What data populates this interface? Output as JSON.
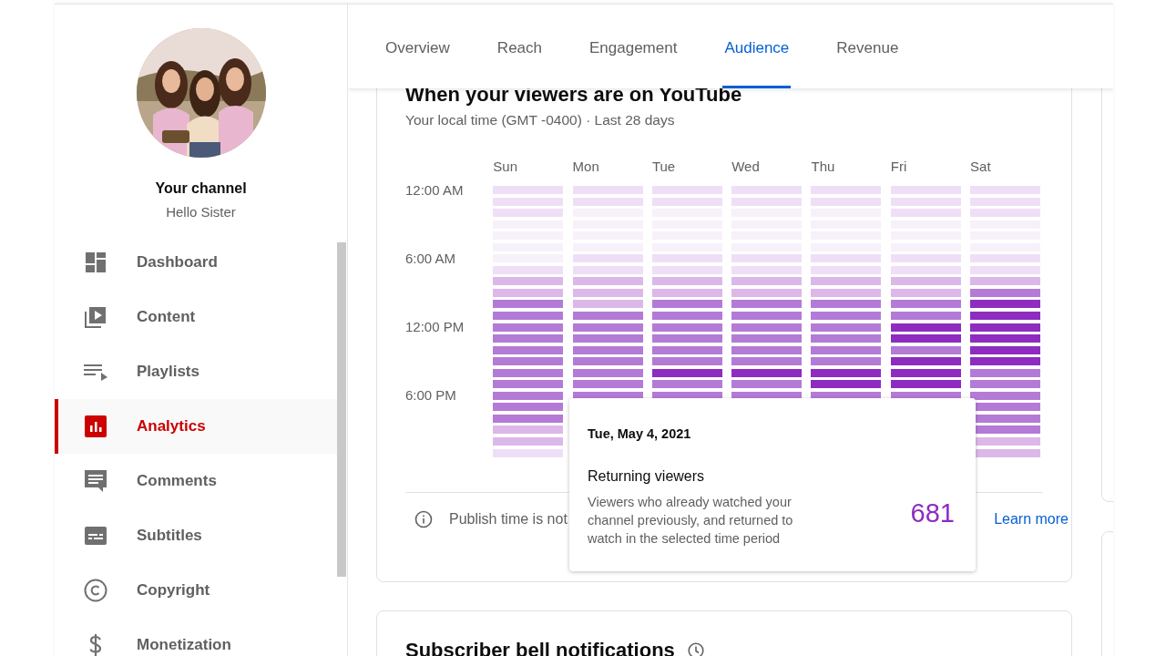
{
  "sidebar": {
    "channel_title": "Your channel",
    "channel_name": "Hello Sister",
    "items": [
      {
        "label": "Dashboard",
        "selected": false
      },
      {
        "label": "Content",
        "selected": false
      },
      {
        "label": "Playlists",
        "selected": false
      },
      {
        "label": "Analytics",
        "selected": true
      },
      {
        "label": "Comments",
        "selected": false
      },
      {
        "label": "Subtitles",
        "selected": false
      },
      {
        "label": "Copyright",
        "selected": false
      },
      {
        "label": "Monetization",
        "selected": false
      }
    ]
  },
  "tabs": [
    {
      "label": "Overview",
      "selected": false
    },
    {
      "label": "Reach",
      "selected": false
    },
    {
      "label": "Engagement",
      "selected": false
    },
    {
      "label": "Audience",
      "selected": true
    },
    {
      "label": "Revenue",
      "selected": false
    }
  ],
  "viewers_card": {
    "title": "When your viewers are on YouTube",
    "subtitle": "Your local time (GMT -0400) · Last 28 days",
    "heatmap": {
      "time_labels": [
        "12:00 AM",
        "6:00 AM",
        "12:00 PM",
        "6:00 PM"
      ],
      "days": [
        {
          "label": "Sun",
          "cells": [
            {
              "color": "#eedff7"
            },
            {
              "color": "#eedff7"
            },
            {
              "color": "#eedff7"
            },
            {
              "color": "#f7f1fa"
            },
            {
              "color": "#f7f1fa"
            },
            {
              "color": "#f7f1fa"
            },
            {
              "color": "#f7f1fa"
            },
            {
              "color": "#eedff7"
            },
            {
              "color": "#dcb8e9"
            },
            {
              "color": "#dcb8e9"
            },
            {
              "color": "#b47bd6"
            },
            {
              "color": "#b47bd6"
            },
            {
              "color": "#b47bd6"
            },
            {
              "color": "#b47bd6"
            },
            {
              "color": "#b47bd6"
            },
            {
              "color": "#b47bd6"
            },
            {
              "color": "#b47bd6"
            },
            {
              "color": "#b47bd6"
            },
            {
              "color": "#b47bd6"
            },
            {
              "color": "#b47bd6"
            },
            {
              "color": "#b47bd6"
            },
            {
              "color": "#dcb8e9"
            },
            {
              "color": "#dcb8e9"
            },
            {
              "color": "#eedff7"
            }
          ]
        },
        {
          "label": "Mon",
          "cells": [
            {
              "color": "#eedff7"
            },
            {
              "color": "#eedff7"
            },
            {
              "color": "#f7f1fa"
            },
            {
              "color": "#f7f1fa"
            },
            {
              "color": "#f7f1fa"
            },
            {
              "color": "#f7f1fa"
            },
            {
              "color": "#eedff7"
            },
            {
              "color": "#eedff7"
            },
            {
              "color": "#dcb8e9"
            },
            {
              "color": "#dcb8e9"
            },
            {
              "color": "#dcb8e9"
            },
            {
              "color": "#b47bd6"
            },
            {
              "color": "#b47bd6"
            },
            {
              "color": "#b47bd6"
            },
            {
              "color": "#b47bd6"
            },
            {
              "color": "#b47bd6"
            },
            {
              "color": "#b47bd6"
            },
            {
              "color": "#b47bd6"
            },
            {
              "color": "#b47bd6"
            }
          ]
        },
        {
          "label": "Tue",
          "cells": [
            {
              "color": "#eedff7"
            },
            {
              "color": "#eedff7"
            },
            {
              "color": "#f7f1fa"
            },
            {
              "color": "#f7f1fa"
            },
            {
              "color": "#f7f1fa"
            },
            {
              "color": "#f7f1fa"
            },
            {
              "color": "#eedff7"
            },
            {
              "color": "#eedff7"
            },
            {
              "color": "#dcb8e9"
            },
            {
              "color": "#dcb8e9"
            },
            {
              "color": "#b47bd6"
            },
            {
              "color": "#b47bd6"
            },
            {
              "color": "#b47bd6"
            },
            {
              "color": "#b47bd6"
            },
            {
              "color": "#b47bd6"
            },
            {
              "color": "#b47bd6"
            },
            {
              "color": "#8e2cc0"
            },
            {
              "color": "#b47bd6"
            },
            {
              "color": "#b47bd6"
            }
          ]
        },
        {
          "label": "Wed",
          "cells": [
            {
              "color": "#eedff7"
            },
            {
              "color": "#eedff7"
            },
            {
              "color": "#f7f1fa"
            },
            {
              "color": "#f7f1fa"
            },
            {
              "color": "#f7f1fa"
            },
            {
              "color": "#f7f1fa"
            },
            {
              "color": "#eedff7"
            },
            {
              "color": "#eedff7"
            },
            {
              "color": "#dcb8e9"
            },
            {
              "color": "#dcb8e9"
            },
            {
              "color": "#b47bd6"
            },
            {
              "color": "#b47bd6"
            },
            {
              "color": "#b47bd6"
            },
            {
              "color": "#b47bd6"
            },
            {
              "color": "#b47bd6"
            },
            {
              "color": "#b47bd6"
            },
            {
              "color": "#8e2cc0"
            },
            {
              "color": "#b47bd6"
            },
            {
              "color": "#b47bd6"
            }
          ]
        },
        {
          "label": "Thu",
          "cells": [
            {
              "color": "#eedff7"
            },
            {
              "color": "#eedff7"
            },
            {
              "color": "#f7f1fa"
            },
            {
              "color": "#f7f1fa"
            },
            {
              "color": "#f7f1fa"
            },
            {
              "color": "#f7f1fa"
            },
            {
              "color": "#eedff7"
            },
            {
              "color": "#eedff7"
            },
            {
              "color": "#dcb8e9"
            },
            {
              "color": "#dcb8e9"
            },
            {
              "color": "#b47bd6"
            },
            {
              "color": "#b47bd6"
            },
            {
              "color": "#b47bd6"
            },
            {
              "color": "#b47bd6"
            },
            {
              "color": "#b47bd6"
            },
            {
              "color": "#b47bd6"
            },
            {
              "color": "#8e2cc0"
            },
            {
              "color": "#8e2cc0"
            },
            {
              "color": "#b47bd6"
            }
          ]
        },
        {
          "label": "Fri",
          "cells": [
            {
              "color": "#eedff7"
            },
            {
              "color": "#eedff7"
            },
            {
              "color": "#eedff7"
            },
            {
              "color": "#f7f1fa"
            },
            {
              "color": "#f7f1fa"
            },
            {
              "color": "#f7f1fa"
            },
            {
              "color": "#eedff7"
            },
            {
              "color": "#eedff7"
            },
            {
              "color": "#dcb8e9"
            },
            {
              "color": "#dcb8e9"
            },
            {
              "color": "#b47bd6"
            },
            {
              "color": "#b47bd6"
            },
            {
              "color": "#8e2cc0"
            },
            {
              "color": "#8e2cc0"
            },
            {
              "color": "#b47bd6"
            },
            {
              "color": "#8e2cc0"
            },
            {
              "color": "#8e2cc0"
            },
            {
              "color": "#8e2cc0"
            },
            {
              "color": "#b47bd6"
            }
          ]
        },
        {
          "label": "Sat",
          "cells": [
            {
              "color": "#eedff7"
            },
            {
              "color": "#eedff7"
            },
            {
              "color": "#eedff7"
            },
            {
              "color": "#f7f1fa"
            },
            {
              "color": "#f7f1fa"
            },
            {
              "color": "#f7f1fa"
            },
            {
              "color": "#eedff7"
            },
            {
              "color": "#eedff7"
            },
            {
              "color": "#dcb8e9"
            },
            {
              "color": "#b47bd6"
            },
            {
              "color": "#8e2cc0"
            },
            {
              "color": "#8e2cc0"
            },
            {
              "color": "#8e2cc0"
            },
            {
              "color": "#8e2cc0"
            },
            {
              "color": "#8e2cc0"
            },
            {
              "color": "#8e2cc0"
            },
            {
              "color": "#b47bd6"
            },
            {
              "color": "#b47bd6"
            },
            {
              "color": "#b47bd6"
            },
            {
              "color": "#b47bd6"
            },
            {
              "color": "#b47bd6"
            },
            {
              "color": "#b47bd6"
            },
            {
              "color": "#dcb8e9"
            },
            {
              "color": "#dcb8e9"
            }
          ]
        }
      ]
    },
    "note": {
      "text": "Publish time is not",
      "link": "Learn more"
    }
  },
  "tooltip": {
    "date": "Tue, May 4, 2021",
    "metric": "Returning viewers",
    "description": "Viewers who already watched your channel previously, and returned to watch in the selected time period",
    "value": "681"
  },
  "bell_card": {
    "title": "Subscriber bell notifications"
  }
}
